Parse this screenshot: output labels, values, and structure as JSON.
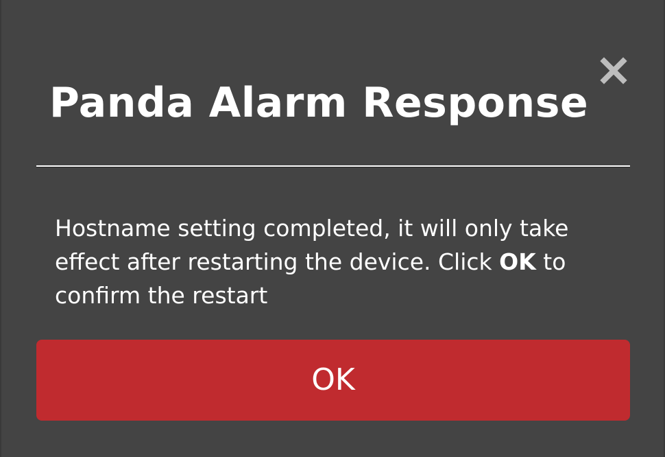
{
  "dialog": {
    "title": "Panda Alarm Response",
    "close_icon": "close-icon",
    "message": {
      "before": "Hostname setting completed, it will only take effect after restarting the device. Click ",
      "emphasis": "OK",
      "after": " to confirm the restart"
    },
    "ok_label": "OK"
  },
  "colors": {
    "background": "#444444",
    "text": "#ffffff",
    "close_icon": "#bdbdbd",
    "ok_button": "#c02b2f"
  }
}
